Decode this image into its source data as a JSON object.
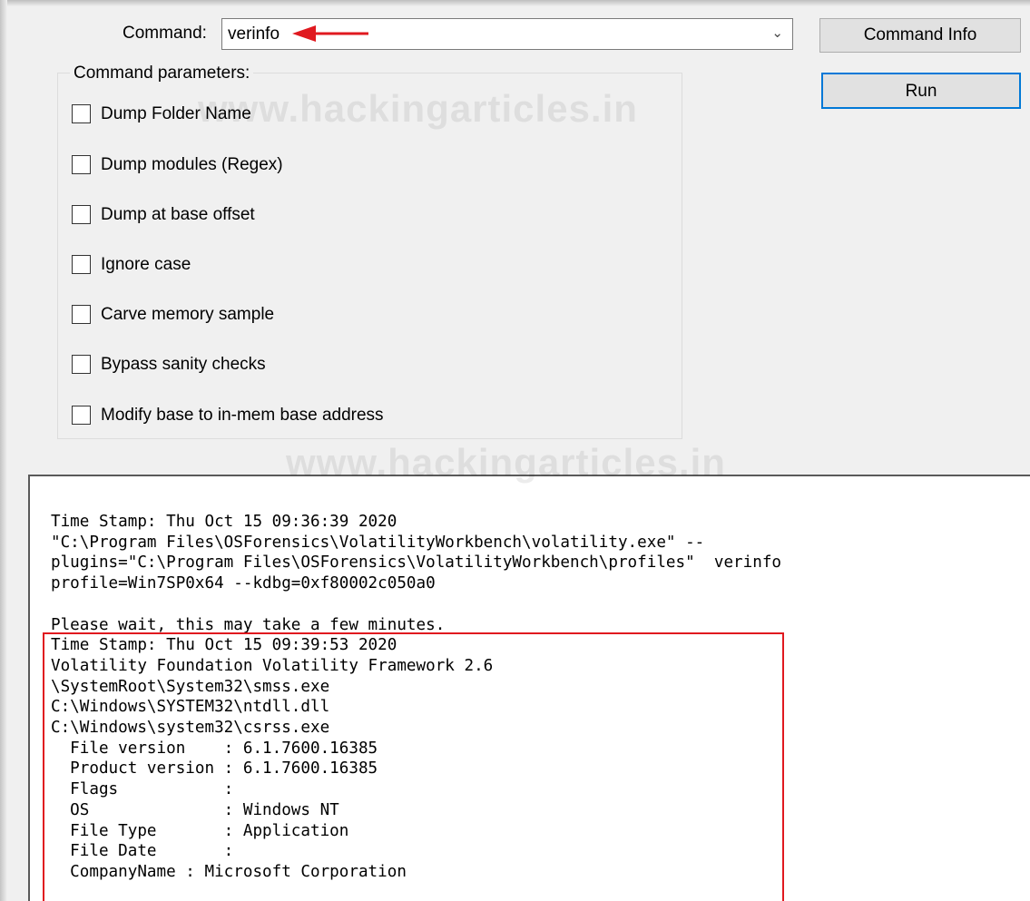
{
  "command_bar": {
    "label": "Command:",
    "value": "verinfo",
    "dropdown_icon": "chevron-down-icon"
  },
  "buttons": {
    "command_info": "Command Info",
    "run": "Run"
  },
  "parameters": {
    "title": "Command parameters:",
    "options": [
      {
        "label": "Dump Folder Name",
        "checked": false
      },
      {
        "label": "Dump modules (Regex)",
        "checked": false
      },
      {
        "label": "Dump at base offset",
        "checked": false
      },
      {
        "label": "Ignore case",
        "checked": false
      },
      {
        "label": "Carve memory sample",
        "checked": false
      },
      {
        "label": "Bypass sanity checks",
        "checked": false
      },
      {
        "label": "Modify base to in-mem base address",
        "checked": false
      }
    ]
  },
  "watermark": "www.hackingarticles.in",
  "annotations": {
    "arrow_color": "#e0191f",
    "box_color": "#e0191f"
  },
  "output": {
    "header_lines": [
      "Time Stamp: Thu Oct 15 09:36:39 2020",
      "\"C:\\Program Files\\OSForensics\\VolatilityWorkbench\\volatility.exe\" --",
      "plugins=\"C:\\Program Files\\OSForensics\\VolatilityWorkbench\\profiles\"  verinfo",
      "profile=Win7SP0x64 --kdbg=0xf80002c050a0",
      "",
      "Please wait, this may take a few minutes."
    ],
    "result_lines": [
      "Time Stamp: Thu Oct 15 09:39:53 2020",
      "Volatility Foundation Volatility Framework 2.6",
      "\\SystemRoot\\System32\\smss.exe",
      "C:\\Windows\\SYSTEM32\\ntdll.dll",
      "C:\\Windows\\system32\\csrss.exe",
      "  File version    : 6.1.7600.16385",
      "  Product version : 6.1.7600.16385",
      "  Flags           :",
      "  OS              : Windows NT",
      "  File Type       : Application",
      "  File Date       :",
      "  CompanyName : Microsoft Corporation"
    ]
  }
}
